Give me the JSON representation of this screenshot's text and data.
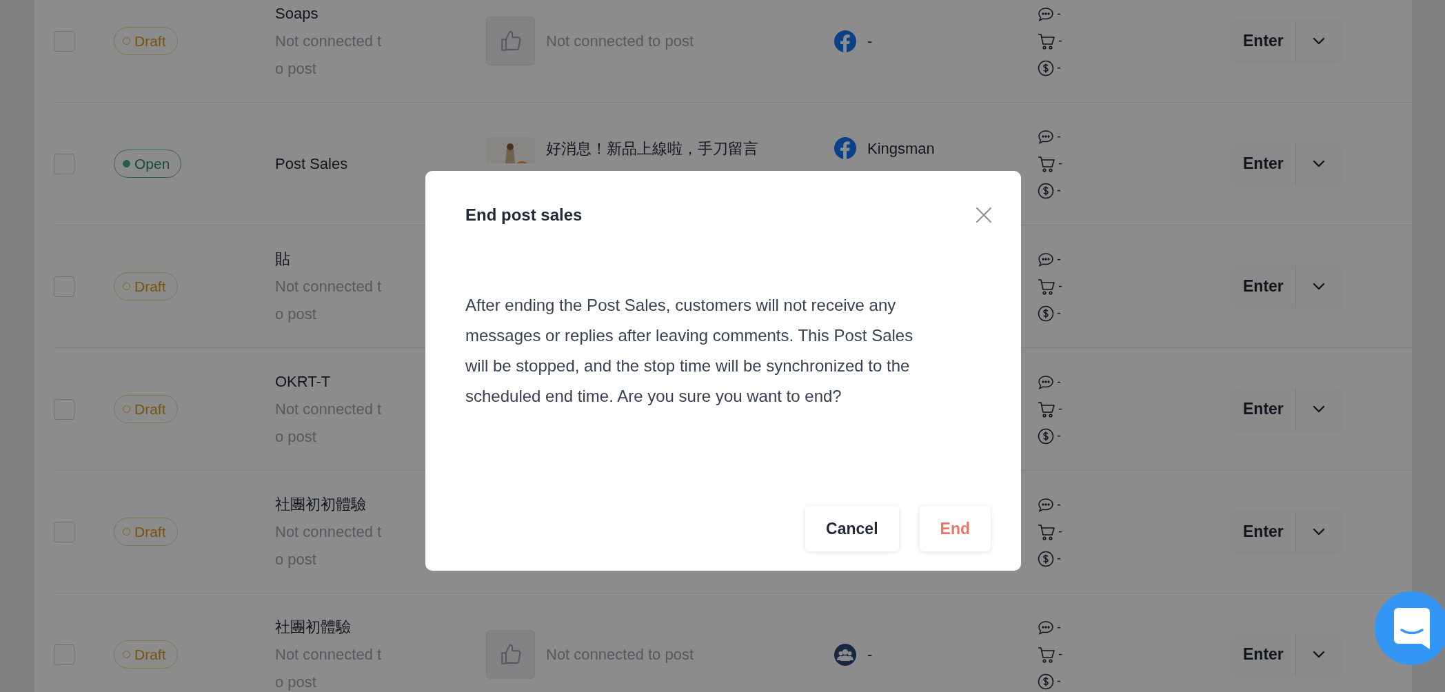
{
  "rows": [
    {
      "checked": false,
      "status": {
        "kind": "draft",
        "label": "Draft"
      },
      "name": "Soaps",
      "note": "Not connected to post",
      "post": {
        "kind": "placeholder",
        "text": "Not connected to post"
      },
      "page": {
        "kind": "facebook",
        "name": "-"
      },
      "stats": [
        "-",
        "-",
        "-"
      ],
      "action": "Enter"
    },
    {
      "checked": false,
      "status": {
        "kind": "open",
        "label": "Open"
      },
      "name": "Post Sales",
      "post": {
        "kind": "picture",
        "text": "好消息！新品上線啦，手刀留言"
      },
      "page": {
        "kind": "facebook",
        "name": "Kingsman"
      },
      "stats": [
        "-",
        "-",
        "-"
      ],
      "action": "Enter"
    },
    {
      "checked": false,
      "status": {
        "kind": "draft",
        "label": "Draft"
      },
      "name": "貼",
      "note": "Not connected to post",
      "stats": [
        "-",
        "-",
        "-"
      ],
      "action": "Enter"
    },
    {
      "checked": false,
      "status": {
        "kind": "draft",
        "label": "Draft"
      },
      "name": "OKRT-T",
      "note": "Not connected to post",
      "stats": [
        "-",
        "-",
        "-"
      ],
      "action": "Enter"
    },
    {
      "checked": false,
      "status": {
        "kind": "draft",
        "label": "Draft"
      },
      "name": "社團初初體驗",
      "note": "Not connected to post",
      "stats": [
        "-",
        "-",
        "-"
      ],
      "action": "Enter"
    },
    {
      "checked": false,
      "status": {
        "kind": "draft",
        "label": "Draft"
      },
      "name": "社團初體驗",
      "note": "Not connected to post",
      "post": {
        "kind": "placeholder",
        "text": "Not connected to post"
      },
      "page": {
        "kind": "group",
        "name": "-"
      },
      "stats": [
        "-",
        "-",
        "-"
      ],
      "action": "Enter"
    }
  ],
  "modal": {
    "title": "End post sales",
    "body": "After ending the Post Sales, customers will not receive any messages or replies after leaving comments. This Post Sales will be stopped, and the stop time will be synchronized to the scheduled end time. Are you sure you want to end?",
    "buttons": [
      {
        "kind": "secondary",
        "label": "Cancel"
      },
      {
        "kind": "danger",
        "label": "End"
      }
    ]
  }
}
